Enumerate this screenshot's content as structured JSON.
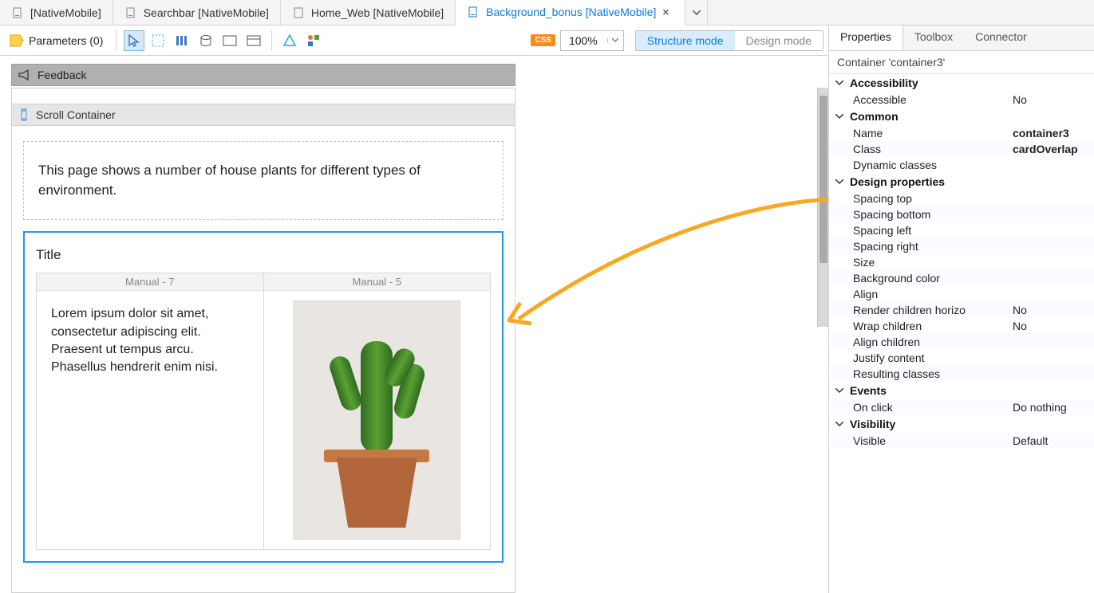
{
  "tabs": [
    {
      "label": "[NativeMobile]"
    },
    {
      "label": "Searchbar [NativeMobile]"
    },
    {
      "label": "Home_Web [NativeMobile]"
    },
    {
      "label": "Background_bonus [NativeMobile]"
    }
  ],
  "toolbar": {
    "parameters_label": "Parameters (0)",
    "zoom": "100%",
    "structure_mode": "Structure mode",
    "design_mode": "Design mode",
    "css_badge": "CSS"
  },
  "canvas": {
    "feedback_label": "Feedback",
    "scroll_container_label": "Scroll Container",
    "description": "This page shows a number of house plants for different types of environment.",
    "card": {
      "title": "Title",
      "col1_head": "Manual - 7",
      "col2_head": "Manual - 5",
      "lorem": "Lorem ipsum dolor sit amet, consectetur adipiscing elit. Praesent ut tempus arcu. Phasellus hendrerit enim nisi."
    }
  },
  "props": {
    "panel_tabs": [
      "Properties",
      "Toolbox",
      "Connector"
    ],
    "header": "Container 'container3'",
    "groups": [
      {
        "title": "Accessibility",
        "rows": [
          {
            "k": "Accessible",
            "v": "No"
          }
        ]
      },
      {
        "title": "Common",
        "rows": [
          {
            "k": "Name",
            "v": "container3",
            "bold": true
          },
          {
            "k": "Class",
            "v": "cardOverlap",
            "bold": true
          },
          {
            "k": "Dynamic classes",
            "v": ""
          }
        ]
      },
      {
        "title": "Design properties",
        "rows": [
          {
            "k": "Spacing top",
            "v": ""
          },
          {
            "k": "Spacing bottom",
            "v": ""
          },
          {
            "k": "Spacing left",
            "v": ""
          },
          {
            "k": "Spacing right",
            "v": ""
          },
          {
            "k": "Size",
            "v": ""
          },
          {
            "k": "Background color",
            "v": ""
          },
          {
            "k": "Align",
            "v": ""
          },
          {
            "k": "Render children horizo",
            "v": "No"
          },
          {
            "k": "Wrap children",
            "v": "No"
          },
          {
            "k": "Align children",
            "v": ""
          },
          {
            "k": "Justify content",
            "v": ""
          },
          {
            "k": "Resulting classes",
            "v": ""
          }
        ]
      },
      {
        "title": "Events",
        "rows": [
          {
            "k": "On click",
            "v": "Do nothing"
          }
        ]
      },
      {
        "title": "Visibility",
        "rows": [
          {
            "k": "Visible",
            "v": "Default"
          }
        ]
      }
    ]
  }
}
